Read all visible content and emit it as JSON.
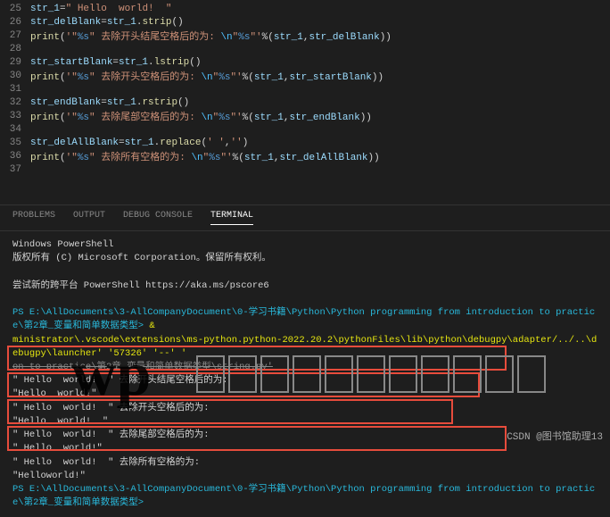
{
  "editor": {
    "lines": [
      {
        "n": 25,
        "segs": [
          {
            "t": "str_1",
            "c": "s-var"
          },
          {
            "t": "=",
            "c": "s-op"
          },
          {
            "t": "\" Hello  world!  \"",
            "c": "s-str"
          }
        ]
      },
      {
        "n": 26,
        "segs": [
          {
            "t": "str_delBlank",
            "c": "s-var"
          },
          {
            "t": "=",
            "c": "s-op"
          },
          {
            "t": "str_1",
            "c": "s-var"
          },
          {
            "t": ".",
            "c": "s-op"
          },
          {
            "t": "strip",
            "c": "s-fn"
          },
          {
            "t": "()",
            "c": "s-op"
          }
        ]
      },
      {
        "n": 27,
        "segs": [
          {
            "t": "print",
            "c": "s-fn"
          },
          {
            "t": "(",
            "c": "s-op"
          },
          {
            "t": "'\"",
            "c": "s-str"
          },
          {
            "t": "%s",
            "c": "s-pct"
          },
          {
            "t": "\" 去除开头结尾空格后的为: ",
            "c": "s-str"
          },
          {
            "t": "\\n",
            "c": "s-cn"
          },
          {
            "t": "\"",
            "c": "s-str"
          },
          {
            "t": "%s",
            "c": "s-pct"
          },
          {
            "t": "\"'",
            "c": "s-str"
          },
          {
            "t": "%(",
            "c": "s-op"
          },
          {
            "t": "str_1",
            "c": "s-var"
          },
          {
            "t": ",",
            "c": "s-op"
          },
          {
            "t": "str_delBlank",
            "c": "s-var"
          },
          {
            "t": "))",
            "c": "s-op"
          }
        ]
      },
      {
        "n": 28,
        "segs": []
      },
      {
        "n": 29,
        "segs": [
          {
            "t": "str_startBlank",
            "c": "s-var"
          },
          {
            "t": "=",
            "c": "s-op"
          },
          {
            "t": "str_1",
            "c": "s-var"
          },
          {
            "t": ".",
            "c": "s-op"
          },
          {
            "t": "lstrip",
            "c": "s-fn"
          },
          {
            "t": "()",
            "c": "s-op"
          }
        ]
      },
      {
        "n": 30,
        "segs": [
          {
            "t": "print",
            "c": "s-fn"
          },
          {
            "t": "(",
            "c": "s-op"
          },
          {
            "t": "'\"",
            "c": "s-str"
          },
          {
            "t": "%s",
            "c": "s-pct"
          },
          {
            "t": "\" 去除开头空格后的为: ",
            "c": "s-str"
          },
          {
            "t": "\\n",
            "c": "s-cn"
          },
          {
            "t": "\"",
            "c": "s-str"
          },
          {
            "t": "%s",
            "c": "s-pct"
          },
          {
            "t": "\"'",
            "c": "s-str"
          },
          {
            "t": "%(",
            "c": "s-op"
          },
          {
            "t": "str_1",
            "c": "s-var"
          },
          {
            "t": ",",
            "c": "s-op"
          },
          {
            "t": "str_startBlank",
            "c": "s-var"
          },
          {
            "t": "))",
            "c": "s-op"
          }
        ]
      },
      {
        "n": 31,
        "segs": []
      },
      {
        "n": 32,
        "segs": [
          {
            "t": "str_endBlank",
            "c": "s-var"
          },
          {
            "t": "=",
            "c": "s-op"
          },
          {
            "t": "str_1",
            "c": "s-var"
          },
          {
            "t": ".",
            "c": "s-op"
          },
          {
            "t": "rstrip",
            "c": "s-fn"
          },
          {
            "t": "()",
            "c": "s-op"
          }
        ]
      },
      {
        "n": 33,
        "segs": [
          {
            "t": "print",
            "c": "s-fn"
          },
          {
            "t": "(",
            "c": "s-op"
          },
          {
            "t": "'\"",
            "c": "s-str"
          },
          {
            "t": "%s",
            "c": "s-pct"
          },
          {
            "t": "\" 去除尾部空格后的为: ",
            "c": "s-str"
          },
          {
            "t": "\\n",
            "c": "s-cn"
          },
          {
            "t": "\"",
            "c": "s-str"
          },
          {
            "t": "%s",
            "c": "s-pct"
          },
          {
            "t": "\"'",
            "c": "s-str"
          },
          {
            "t": "%(",
            "c": "s-op"
          },
          {
            "t": "str_1",
            "c": "s-var"
          },
          {
            "t": ",",
            "c": "s-op"
          },
          {
            "t": "str_endBlank",
            "c": "s-var"
          },
          {
            "t": "))",
            "c": "s-op"
          }
        ]
      },
      {
        "n": 34,
        "segs": []
      },
      {
        "n": 35,
        "segs": [
          {
            "t": "str_delAllBlank",
            "c": "s-var"
          },
          {
            "t": "=",
            "c": "s-op"
          },
          {
            "t": "str_1",
            "c": "s-var"
          },
          {
            "t": ".",
            "c": "s-op"
          },
          {
            "t": "replace",
            "c": "s-fn"
          },
          {
            "t": "(",
            "c": "s-op"
          },
          {
            "t": "' '",
            "c": "s-str"
          },
          {
            "t": ",",
            "c": "s-op"
          },
          {
            "t": "''",
            "c": "s-str"
          },
          {
            "t": ")",
            "c": "s-op"
          }
        ]
      },
      {
        "n": 36,
        "segs": [
          {
            "t": "print",
            "c": "s-fn"
          },
          {
            "t": "(",
            "c": "s-op"
          },
          {
            "t": "'\"",
            "c": "s-str"
          },
          {
            "t": "%s",
            "c": "s-pct"
          },
          {
            "t": "\" 去除所有空格的为: ",
            "c": "s-str"
          },
          {
            "t": "\\n",
            "c": "s-cn"
          },
          {
            "t": "\"",
            "c": "s-str"
          },
          {
            "t": "%s",
            "c": "s-pct"
          },
          {
            "t": "\"'",
            "c": "s-str"
          },
          {
            "t": "%(",
            "c": "s-op"
          },
          {
            "t": "str_1",
            "c": "s-var"
          },
          {
            "t": ",",
            "c": "s-op"
          },
          {
            "t": "str_delAllBlank",
            "c": "s-var"
          },
          {
            "t": "))",
            "c": "s-op"
          }
        ]
      },
      {
        "n": 37,
        "segs": []
      }
    ]
  },
  "tabs": {
    "problems": "PROBLEMS",
    "output": "OUTPUT",
    "debug": "DEBUG CONSOLE",
    "terminal": "TERMINAL"
  },
  "terminal": {
    "l1": "Windows PowerShell",
    "l2": "版权所有 (C) Microsoft Corporation。保留所有权利。",
    "l3": "尝试新的跨平台 PowerShell https://aka.ms/pscore6",
    "ps1a": "PS E:\\AllDocuments\\3-AllCompanyDocument\\0-学习书籍\\Python\\Python programming from introduction to practice\\第2章_变量和简单数据类型>",
    "ps1b": "& ",
    "cmd1": "ministrator\\.vscode\\extensions\\ms-python.python-2022.20.2\\pythonFiles\\lib\\python\\debugpy\\adapter/../..\\debugpy\\launcher' '57326' '--' '",
    "cmd2": "on to practice\\第2章_变量和简单数据类型\\string.py'",
    "o1": "\" Hello  world!  \" 去除开头结尾空格后的为:",
    "o2": "\"Hello  world!\"",
    "o3": "\" Hello  world!  \" 去除开头空格后的为:",
    "o4": "\"Hello  world!  \"",
    "o5": "\" Hello  world!  \" 去除尾部空格后的为:",
    "o6": "\" Hello  world!\"",
    "o7": "\" Hello  world!  \" 去除所有空格的为:",
    "o8": "\"Helloworld!\"",
    "ps2": "PS E:\\AllDocuments\\3-AllCompanyDocument\\0-学习书籍\\Python\\Python programming from introduction to practice\\第2章_变量和简单数据类型>"
  },
  "watermark": {
    "text": "wp",
    "right": "CSDN @图书馆助理13"
  }
}
